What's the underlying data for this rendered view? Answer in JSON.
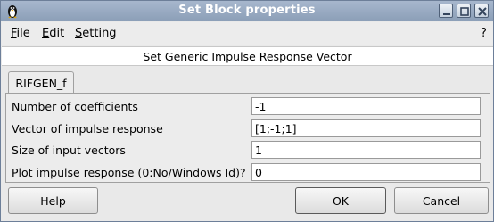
{
  "window": {
    "title": "Set Block properties",
    "app_icon": "scilab-penguin-icon"
  },
  "menubar": {
    "file": "File",
    "edit": "Edit",
    "setting": "Setting",
    "help": "?"
  },
  "dialog": {
    "header": "Set Generic Impulse Response Vector",
    "tab_label": "RIFGEN_f",
    "fields": [
      {
        "label": "Number of coefficients",
        "value": "-1"
      },
      {
        "label": "Vector of impulse response",
        "value": "[1;-1;1]"
      },
      {
        "label": "Size of input vectors",
        "value": "1"
      },
      {
        "label": "Plot impulse response (0:No/Windows Id)?",
        "value": "0"
      }
    ]
  },
  "buttons": {
    "help": "Help",
    "ok": "OK",
    "cancel": "Cancel"
  },
  "colors": {
    "titlebar": "#9aabc3",
    "window_bg": "#e9e9e9"
  }
}
